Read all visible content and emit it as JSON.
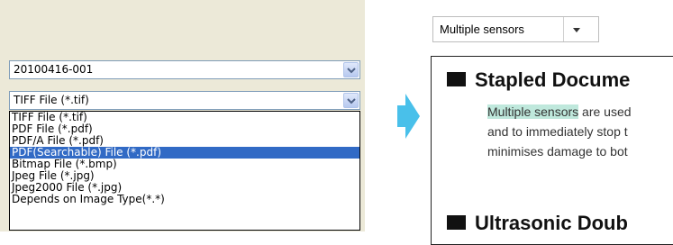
{
  "left_panel": {
    "batch_combo": {
      "value": "20100416-001"
    },
    "format_combo": {
      "value": "TIFF File (*.tif)"
    },
    "format_options": [
      "TIFF File (*.tif)",
      "PDF File (*.pdf)",
      "PDF/A File (*.pdf)",
      "PDF(Searchable) File (*.pdf)",
      "Bitmap File (*.bmp)",
      "Jpeg File (*.jpg)",
      "Jpeg2000 File (*.jpg)",
      "Depends on Image Type(*.*)"
    ],
    "selected_index": 3
  },
  "arrow": {
    "icon": "arrow-right-icon",
    "color": "#49c0ea"
  },
  "right_panel": {
    "sensor_select": {
      "value": "Multiple sensors",
      "icon": "chevron-down-icon"
    },
    "doc": {
      "heading_1": "Stapled Docume",
      "para_highlight": "Multiple sensors",
      "para_line_1_rest": " are used",
      "para_line_2": "and to immediately stop t",
      "para_line_3": "minimises damage to bot",
      "heading_2": "Ultrasonic Doub"
    },
    "highlight_color": "#bfe8dc"
  }
}
